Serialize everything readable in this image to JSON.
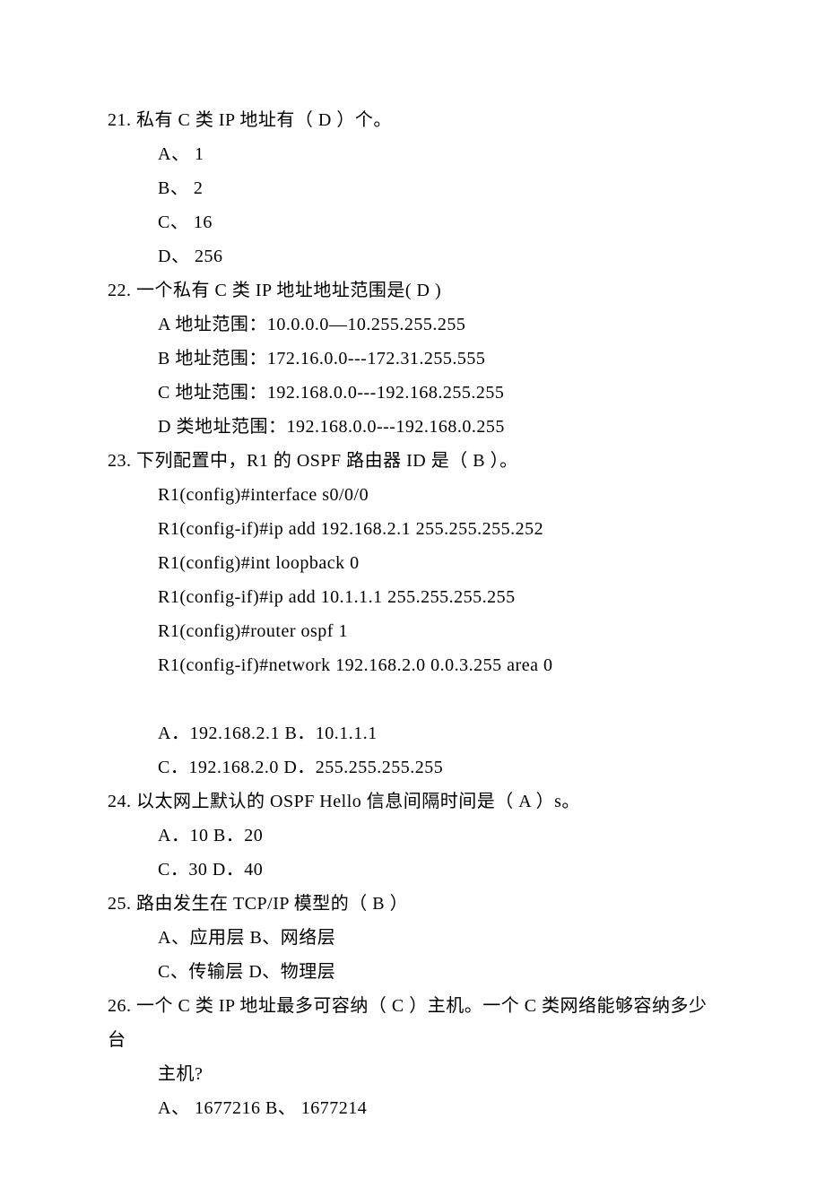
{
  "q21": {
    "line": "21. 私有 C 类 IP 地址有（ D  ）个。",
    "a": "A、  1",
    "b": "B、  2",
    "c": "C、  16",
    "d": "D、  256"
  },
  "q22": {
    "line": "22. 一个私有 C 类 IP 地址地址范围是(  D   )",
    "a": "A 地址范围：10.0.0.0—10.255.255.255",
    "b": "B 地址范围：172.16.0.0---172.31.255.555",
    "c": "C 地址范围：192.168.0.0---192.168.255.255",
    "d": "D 类地址范围：192.168.0.0---192.168.0.255"
  },
  "q23": {
    "line": "23. 下列配置中，R1 的 OSPF 路由器 ID 是（ B  ）。",
    "cfg1": "R1(config)#interface  s0/0/0",
    "cfg2": "R1(config-if)#ip add 192.168.2.1 255.255.255.252",
    "cfg3": "R1(config)#int loopback 0",
    "cfg4": "R1(config-if)#ip add 10.1.1.1 255.255.255.255",
    "cfg5": "R1(config)#router ospf 1",
    "cfg6": "R1(config-if)#network 192.168.2.0 0.0.3.255 area 0",
    "ab": "A．192.168.2.1    B．10.1.1.1",
    "cd": "C．192.168.2.0    D．255.255.255.255"
  },
  "q24": {
    "line": "24. 以太网上默认的 OSPF Hello 信息间隔时间是（ A   ）s。",
    "ab": "A．10        B．20",
    "cd": "C．30        D．40"
  },
  "q25": {
    "line": "25. 路由发生在 TCP/IP 模型的（  B   ）",
    "ab": "A、应用层        B、网络层",
    "cd": "C、传输层        D、物理层"
  },
  "q26": {
    "line1": "26. 一个 C 类 IP 地址最多可容纳（ C   ）主机。一个 C 类网络能够容纳多少台",
    "line2": "主机?",
    "ab": "A、  1677216     B、  1677214"
  }
}
